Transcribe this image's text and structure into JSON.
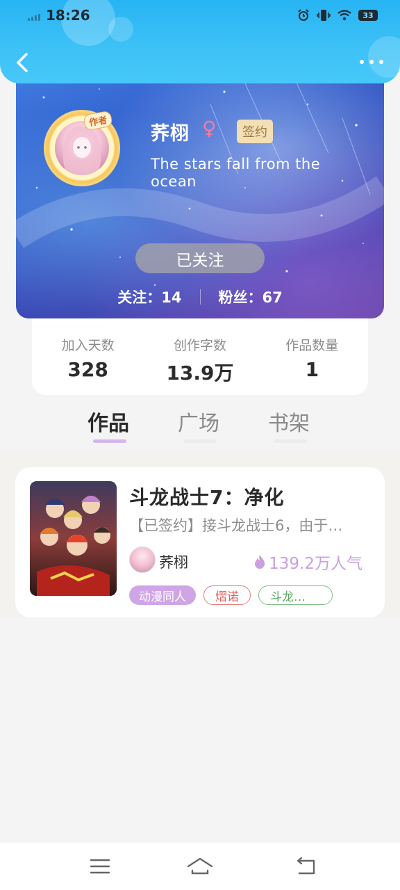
{
  "status_bar": {
    "time": "18:26",
    "battery": "33",
    "icons": [
      "alarm-icon",
      "vibrate-icon",
      "wifi-icon",
      "battery-icon"
    ]
  },
  "nav": {
    "back_icon": "chevron-left-icon",
    "more_icon": "more-dots-icon"
  },
  "profile": {
    "author_badge": "作者",
    "name": "荞栩",
    "gender_symbol": "♀",
    "signed_label": "签约",
    "bio": "The stars fall from the ocean",
    "follow_button": "已关注",
    "following": "关注：14",
    "followers": "粉丝：67"
  },
  "stats": [
    {
      "label": "加入天数",
      "value": "328"
    },
    {
      "label": "创作字数",
      "value": "13.9万"
    },
    {
      "label": "作品数量",
      "value": "1"
    }
  ],
  "tabs": [
    {
      "label": "作品",
      "active": true
    },
    {
      "label": "广场",
      "active": false
    },
    {
      "label": "书架",
      "active": false
    }
  ],
  "works": [
    {
      "title": "斗龙战士7：净化",
      "description": "【已签约】接斗龙战士6，由于…",
      "author": "荞栩",
      "popularity": "139.2万人气",
      "tags": [
        "动漫同人",
        "熠诺",
        "斗龙…"
      ]
    }
  ],
  "colors": {
    "header": "#3ec2f7",
    "accent_purple": "#cfa5e6",
    "tag_red": "#e97b7b",
    "tag_green": "#7cc283",
    "popularity": "#c9a0e0"
  },
  "bottom_nav": [
    "menu-icon",
    "home-icon",
    "back-icon"
  ]
}
